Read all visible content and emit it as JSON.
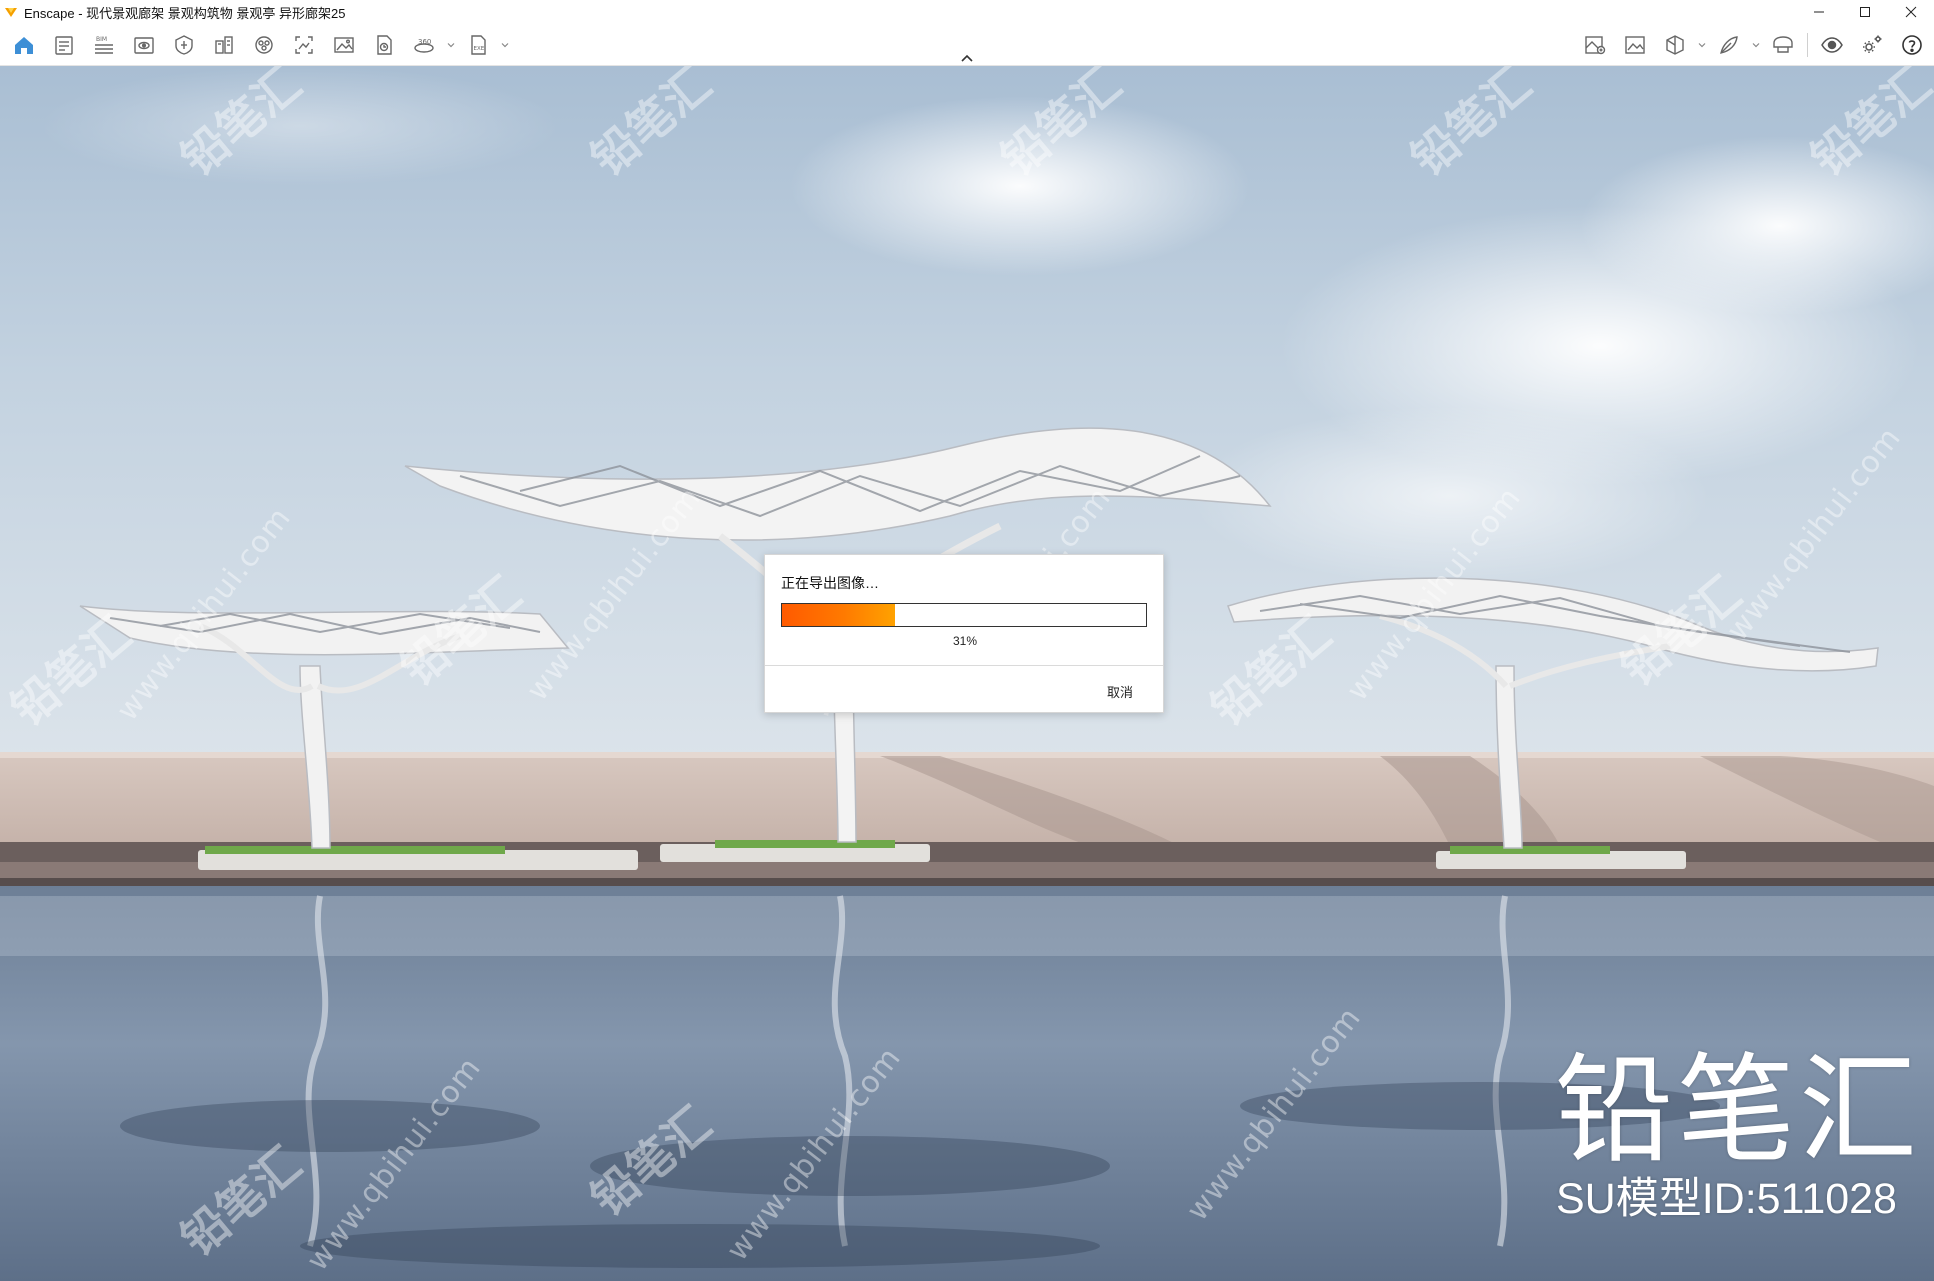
{
  "window": {
    "title": "Enscape - 现代景观廊架 景观构筑物 景观亭 异形廊架25",
    "controls": [
      "minimize-icon",
      "maximize-icon",
      "close-icon"
    ]
  },
  "toolbar": {
    "left_icons": [
      "home-icon",
      "assets-icon",
      "bim-icon",
      "view-mode-icon",
      "material-icon",
      "site-context-icon",
      "panorama-icon",
      "capture-icon",
      "gallery-icon",
      "batch-render-icon",
      "360-export-icon",
      "exe-export-icon"
    ],
    "right_icons": [
      "asset-library-icon",
      "image-export-icon",
      "section-icon",
      "atmosphere-icon",
      "vr-headset-icon",
      "visual-settings-icon",
      "settings-icon",
      "help-icon"
    ],
    "collapse_icon": "chevron-up-icon"
  },
  "dialog": {
    "title": "正在导出图像…",
    "progress": 31,
    "progress_text": "31%",
    "cancel_label": "取消",
    "accent_color": "#ff6a00"
  },
  "branding": {
    "logo_text": "铅笔汇",
    "model_id_text": "SU模型ID:511028"
  },
  "watermark": {
    "url_text": "www.qbihui.com",
    "name_text": "铅笔汇"
  }
}
